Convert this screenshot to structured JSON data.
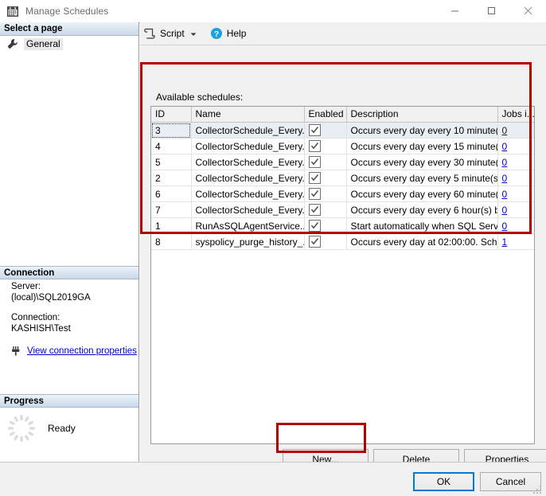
{
  "window": {
    "title": "Manage Schedules",
    "icon": "calendar-icon",
    "minimize_label": "Minimize",
    "maximize_label": "Maximize",
    "close_label": "Close"
  },
  "sidebar": {
    "select_page_header": "Select a page",
    "pages": [
      {
        "label": "General",
        "icon": "wrench-icon",
        "selected": true
      }
    ],
    "connection_header": "Connection",
    "connection": {
      "server_label": "Server:",
      "server_value": "(local)\\SQL2019GA",
      "connection_label": "Connection:",
      "connection_value": "KASHISH\\Test",
      "view_properties_link": "View connection properties",
      "link_icon": "connection-icon",
      "link_color": "#0000cc"
    },
    "progress_header": "Progress",
    "progress": {
      "status": "Ready",
      "icon": "spinner-icon"
    }
  },
  "toolbar": {
    "script_label": "Script",
    "script_icon": "script-icon",
    "script_caret_icon": "chevron-down-icon",
    "help_label": "Help",
    "help_icon": "help-icon",
    "help_color": "#1ba1e2"
  },
  "main": {
    "available_label": "Available schedules:",
    "columns": [
      {
        "key": "id",
        "label": "ID"
      },
      {
        "key": "name",
        "label": "Name"
      },
      {
        "key": "enabled",
        "label": "Enabled"
      },
      {
        "key": "description",
        "label": "Description"
      },
      {
        "key": "jobs",
        "label": "Jobs i..."
      }
    ],
    "rows": [
      {
        "id": "3",
        "name": "CollectorSchedule_Every...",
        "enabled": true,
        "description": "Occurs every day every 10 minute(...",
        "jobs": "0",
        "selected": true
      },
      {
        "id": "4",
        "name": "CollectorSchedule_Every...",
        "enabled": true,
        "description": "Occurs every day every 15 minute(...",
        "jobs": "0",
        "selected": false
      },
      {
        "id": "5",
        "name": "CollectorSchedule_Every...",
        "enabled": true,
        "description": "Occurs every day every 30 minute(...",
        "jobs": "0",
        "selected": false
      },
      {
        "id": "2",
        "name": "CollectorSchedule_Every...",
        "enabled": true,
        "description": "Occurs every day every 5 minute(s)...",
        "jobs": "0",
        "selected": false
      },
      {
        "id": "6",
        "name": "CollectorSchedule_Every...",
        "enabled": true,
        "description": "Occurs every day every 60 minute(...",
        "jobs": "0",
        "selected": false
      },
      {
        "id": "7",
        "name": "CollectorSchedule_Every...",
        "enabled": true,
        "description": "Occurs every day every 6 hour(s) b...",
        "jobs": "0",
        "selected": false
      },
      {
        "id": "1",
        "name": "RunAsSQLAgentService...",
        "enabled": true,
        "description": "Start automatically when SQL Serv...",
        "jobs": "0",
        "selected": false
      },
      {
        "id": "8",
        "name": "syspolicy_purge_history_...",
        "enabled": true,
        "description": "Occurs every day at 02:00:00. Sch...",
        "jobs": "1",
        "selected": false
      }
    ],
    "buttons": {
      "new": "New...",
      "delete": "Delete",
      "properties": "Properties"
    }
  },
  "footer": {
    "ok": "OK",
    "cancel": "Cancel"
  },
  "annotations": {
    "color": "#b00000",
    "highlighted_regions": [
      "available-schedules-table",
      "new-button"
    ]
  }
}
